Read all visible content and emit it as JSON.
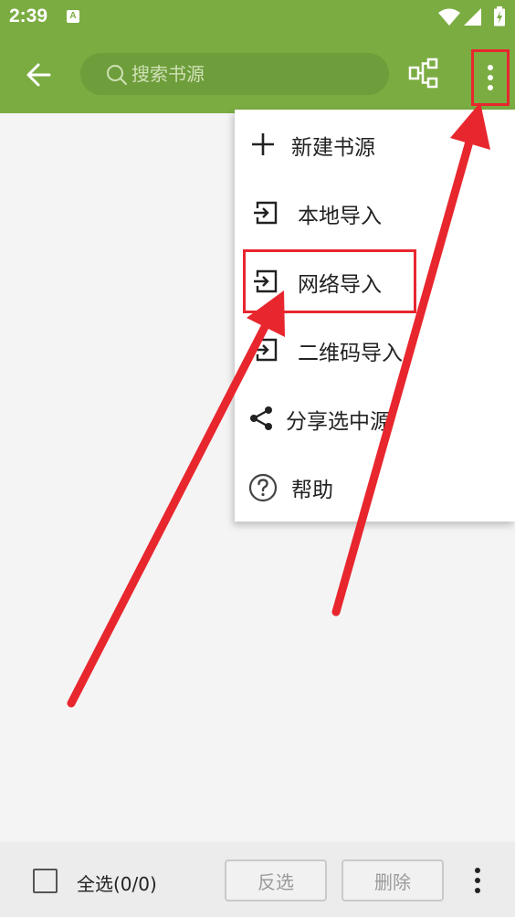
{
  "status_bar": {
    "time": "2:39",
    "notification_badge": "A"
  },
  "toolbar": {
    "back_icon": "arrow-left-icon",
    "search_placeholder": "搜索书源",
    "group_icon": "group-tree-icon",
    "more_icon": "more-vertical-icon"
  },
  "menu": {
    "items": [
      {
        "label": "新建书源",
        "icon": "plus-icon"
      },
      {
        "label": "本地导入",
        "icon": "import-icon"
      },
      {
        "label": "网络导入",
        "icon": "import-icon"
      },
      {
        "label": "二维码导入",
        "icon": "import-icon"
      },
      {
        "label": "分享选中源",
        "icon": "share-icon"
      },
      {
        "label": "帮助",
        "icon": "help-icon"
      }
    ]
  },
  "bottom_bar": {
    "select_all_label": "全选(0/0)",
    "invert_label": "反选",
    "delete_label": "删除"
  },
  "colors": {
    "toolbar": "#7bac42",
    "search_background": "#6e9d3b",
    "annotation": "#e8262e"
  }
}
